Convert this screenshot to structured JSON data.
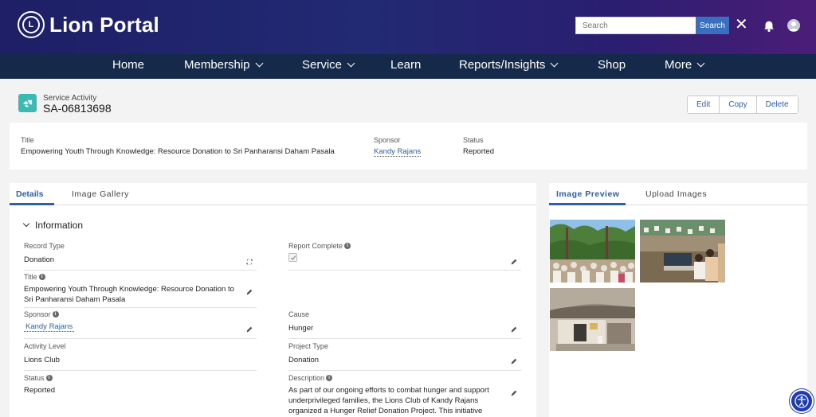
{
  "header": {
    "brand": "Lion Portal",
    "search_placeholder": "Search",
    "search_button": "Search",
    "close_glyph": "✕",
    "icons": [
      "lions-logo-icon",
      "close-icon",
      "bell-icon",
      "user-avatar-icon"
    ],
    "gradient": [
      "#1e1f66",
      "#4b1d78"
    ]
  },
  "nav": {
    "items": [
      {
        "label": "Home",
        "has_dropdown": false
      },
      {
        "label": "Membership",
        "has_dropdown": true
      },
      {
        "label": "Service",
        "has_dropdown": true
      },
      {
        "label": "Learn",
        "has_dropdown": false
      },
      {
        "label": "Reports/Insights",
        "has_dropdown": true
      },
      {
        "label": "Shop",
        "has_dropdown": false
      },
      {
        "label": "More",
        "has_dropdown": true
      }
    ],
    "background": "#152a4b"
  },
  "record": {
    "object_type": "Service Activity",
    "id": "SA-06813698",
    "icon": "service-activity-icon",
    "actions": [
      "Edit",
      "Copy",
      "Delete"
    ]
  },
  "highlights": {
    "title_label": "Title",
    "title_value": "Empowering Youth Through Knowledge: Resource Donation to Sri Panharansi Daham Pasala",
    "sponsor_label": "Sponsor",
    "sponsor_value": "Kandy Rajans",
    "status_label": "Status",
    "status_value": "Reported"
  },
  "details": {
    "tabs": [
      "Details",
      "Image Gallery"
    ],
    "active_tab": "Details",
    "section": "Information",
    "fields": {
      "record_type": {
        "label": "Record Type",
        "value": "Donation"
      },
      "report_complete": {
        "label": "Report Complete",
        "checked": true
      },
      "title": {
        "label": "Title",
        "value": "Empowering Youth Through Knowledge: Resource Donation to Sri Panharansi Daham Pasala"
      },
      "sponsor": {
        "label": "Sponsor",
        "value": "Kandy Rajans"
      },
      "cause": {
        "label": "Cause",
        "value": "Hunger"
      },
      "activity_level": {
        "label": "Activity Level",
        "value": "Lions Club"
      },
      "project_type": {
        "label": "Project Type",
        "value": "Donation"
      },
      "status": {
        "label": "Status",
        "value": "Reported"
      },
      "description": {
        "label": "Description",
        "value": "As part of our ongoing efforts to combat hunger and support underprivileged families, the Lions Club of Kandy Rajans organized a Hunger Relief Donation Project. This initiative aimed"
      }
    }
  },
  "image_panel": {
    "tabs": [
      "Image Preview",
      "Upload Images"
    ],
    "active_tab": "Image Preview",
    "images": [
      "photo-crowd-under-trees",
      "photo-event-stage",
      "photo-temple-building"
    ]
  },
  "accessibility_icon": "accessibility-icon",
  "colors": {
    "link": "#2e5fa8",
    "accent_teal": "#3bbab4",
    "search_button": "#3a6fbf"
  }
}
